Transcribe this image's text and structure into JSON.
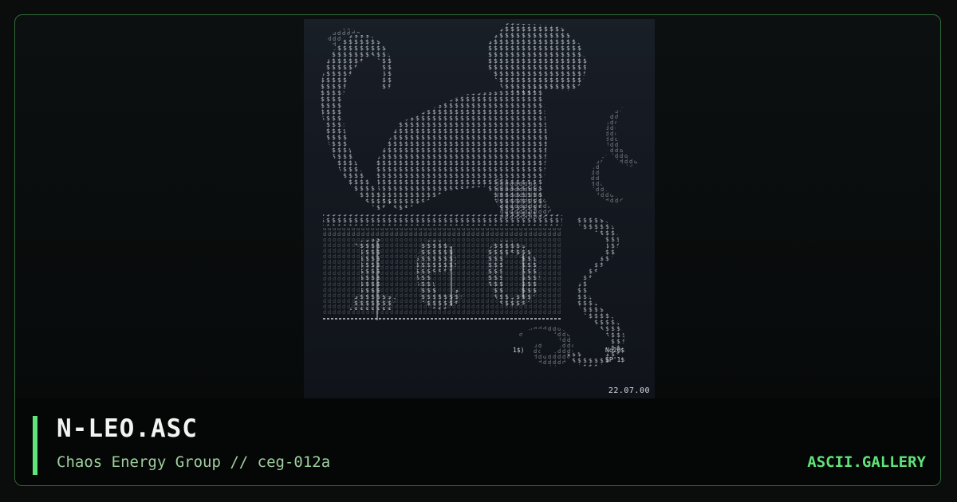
{
  "card": {
    "title": "N-LEO.ASC",
    "subtitle": "Chaos Energy Group // ceg-012a",
    "brand": "ASCII.GALLERY"
  },
  "artwork": {
    "date_text": "22.07.00",
    "glyph_rows": [
      "yyy$$$yyy",
      "$$$$$$$$$$$yy",
      "d$$$$$$$$$$$$$y",
      "$$$$$$$$$$$$$$$$b",
      "$$$$$$$$$$$$$$$$$)",
      "y$$$$$$$$$$$$$$$$$$",
      "yd$$$$$$$$$$$$$$$$$$$",
      "$$$$$$$$$$$$$$$$$$$$$$$$",
      "y$$$$$$$$$$$$$$$$$$$$$$$$$$",
      "d$$$$$$$$$$$$$$$$$$$$$$$$$$$$$$",
      "$$$$$$$$$$$$$$$$$$$$$$$$$$$$$$$$$$$",
      "$$$$$$$$$$$$$$$$$$$$$$$$$$$$$$$$$$$$$",
      "$$$$$$$$$$$$$$$$$$$$$$$$$$$$$$$$$$$$$$$$",
      "$$$$$$$$$$$$$$$$$$$$$$$$$$$$$$$$$$$$$$$$$$"
    ],
    "colors": {
      "glyph": "#c9ced6",
      "glyph_dim": "#7d848e"
    }
  },
  "colors": {
    "accent": "#5fe47a",
    "frame_border": "#2f6b3a",
    "subtitle": "#9fcf9f",
    "title": "#f2f4f2"
  }
}
